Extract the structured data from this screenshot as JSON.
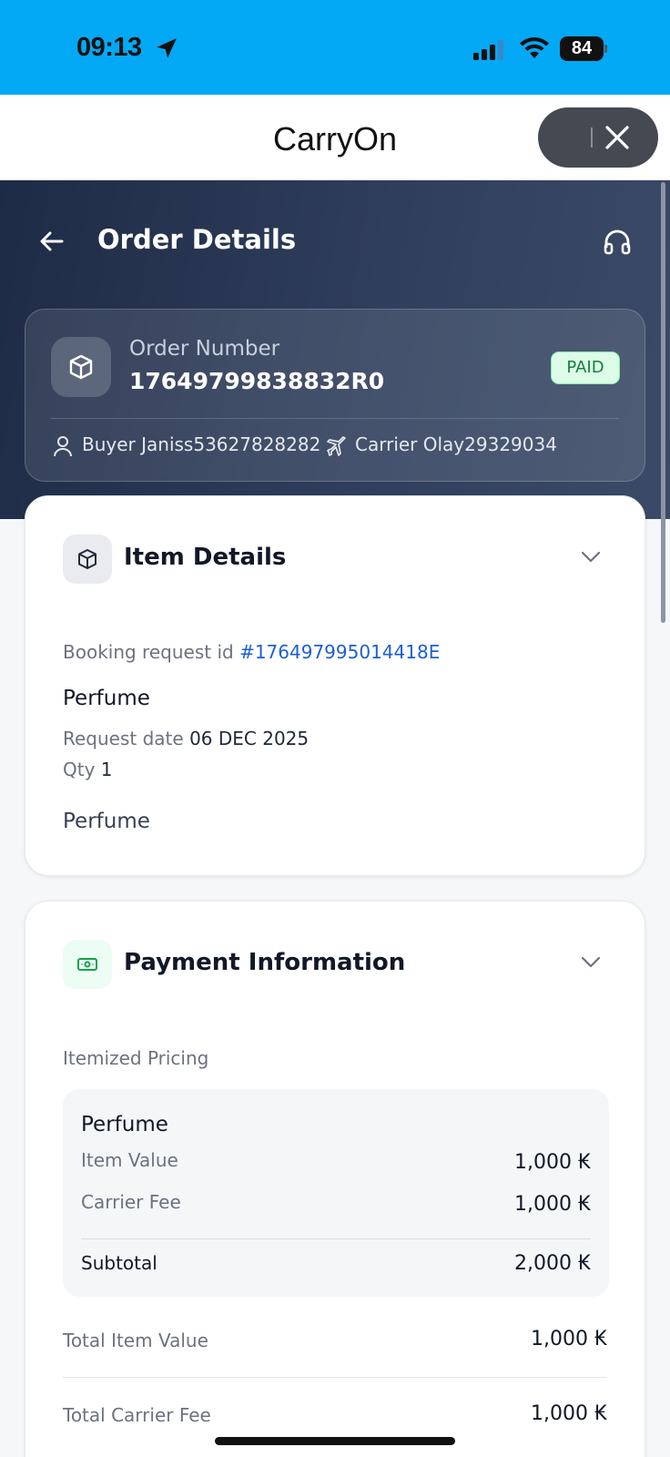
{
  "status_bar": {
    "time": "09:13",
    "battery": "84"
  },
  "app": {
    "title": "CarryOn"
  },
  "header": {
    "title": "Order Details"
  },
  "order": {
    "number_label": "Order Number",
    "number": "17649799838832R0",
    "status": "PAID",
    "buyer": "Buyer Janiss53627828282",
    "carrier": "Carrier Olay29329034"
  },
  "item_details": {
    "title": "Item Details",
    "booking_label": "Booking request id",
    "booking_id": "#176497995014418E",
    "item_name": "Perfume",
    "request_date_label": "Request date",
    "request_date": "06 DEC 2025",
    "qty_label": "Qty",
    "qty": "1",
    "description": "Perfume"
  },
  "payment": {
    "title": "Payment Information",
    "itemized_label": "Itemized Pricing",
    "item": {
      "name": "Perfume",
      "item_value_label": "Item Value",
      "item_value": "1,000 ₭",
      "carrier_fee_label": "Carrier Fee",
      "carrier_fee": "1,000 ₭",
      "subtotal_label": "Subtotal",
      "subtotal": "2,000 ₭"
    },
    "total_item_value_label": "Total Item Value",
    "total_item_value": "1,000 ₭",
    "total_carrier_fee_label": "Total Carrier Fee",
    "total_carrier_fee": "1,000 ₭"
  },
  "colors": {
    "status_bar": "#03a9f4",
    "header_bg": "#1e2b46",
    "paid_badge": "#dcfce7",
    "link": "#1d5fd1",
    "payment_icon": "#16a34a"
  }
}
